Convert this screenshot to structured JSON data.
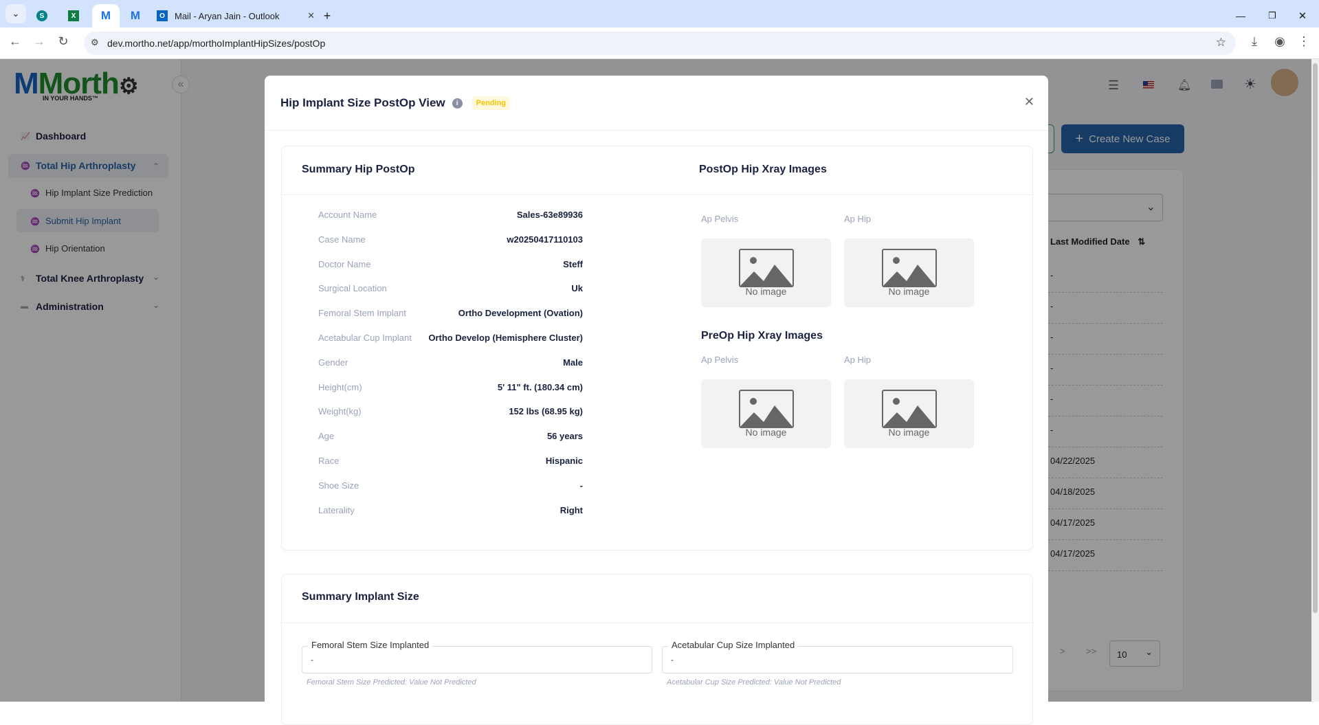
{
  "browser": {
    "tabs": [
      {
        "icon": "sharepoint-icon",
        "label": ""
      },
      {
        "icon": "excel-icon",
        "label": ""
      },
      {
        "icon": "mortho-icon",
        "label": "M",
        "active": true
      },
      {
        "icon": "mortho-icon",
        "label": "M"
      },
      {
        "icon": "outlook-icon",
        "label": "Mail - Aryan Jain - Outlook"
      }
    ],
    "url": "dev.mortho.net/app/morthoImplantHipSizes/postOp",
    "new_tab": "+",
    "close_tab": "✕"
  },
  "app": {
    "logo_text": "Morth",
    "logo_tagline": "IN YOUR HANDS™",
    "accent": "#2563a8"
  },
  "sidebar": {
    "items": [
      {
        "label": "Dashboard"
      },
      {
        "label": "Total Hip Arthroplasty",
        "expanded": true,
        "active": true
      },
      {
        "label": "Hip Implant Size Prediction"
      },
      {
        "label": "Submit Hip Implant",
        "active": true
      },
      {
        "label": "Hip Orientation"
      },
      {
        "label": "Total Knee Arthroplasty"
      },
      {
        "label": "Administration"
      }
    ]
  },
  "background": {
    "create_button": "Create New Case",
    "column_header": "Last Modified Date",
    "rows": [
      "-",
      "-",
      "-",
      "-",
      "-",
      "-",
      "04/22/2025",
      "04/18/2025",
      "04/17/2025",
      "04/17/2025"
    ],
    "page_size": "10",
    "next": ">",
    "last": ">>"
  },
  "modal": {
    "title": "Hip Implant Size PostOp View",
    "status": "Pending",
    "status_color": "#f5c400",
    "summary": {
      "title": "Summary Hip PostOp",
      "rows": [
        {
          "label": "Account Name",
          "value": "Sales-63e89936"
        },
        {
          "label": "Case Name",
          "value": "w20250417110103"
        },
        {
          "label": "Doctor Name",
          "value": "Steff"
        },
        {
          "label": "Surgical Location",
          "value": "Uk"
        },
        {
          "label": "Femoral Stem Implant",
          "value": "Ortho Development (Ovation)"
        },
        {
          "label": "Acetabular Cup Implant",
          "value": "Ortho Develop (Hemisphere Cluster)"
        },
        {
          "label": "Gender",
          "value": "Male"
        },
        {
          "label": "Height(cm)",
          "value": "5' 11\" ft. (180.34 cm)"
        },
        {
          "label": "Weight(kg)",
          "value": "152 lbs (68.95 kg)"
        },
        {
          "label": "Age",
          "value": "56 years"
        },
        {
          "label": "Race",
          "value": "Hispanic"
        },
        {
          "label": "Shoe Size",
          "value": "-"
        },
        {
          "label": "Laterality",
          "value": "Right"
        }
      ]
    },
    "postop_images": {
      "title": "PostOp Hip Xray Images",
      "items": [
        {
          "label": "Ap Pelvis",
          "placeholder": "No image"
        },
        {
          "label": "Ap Hip",
          "placeholder": "No image"
        }
      ]
    },
    "preop_images": {
      "title": "PreOp Hip Xray Images",
      "items": [
        {
          "label": "Ap Pelvis",
          "placeholder": "No image"
        },
        {
          "label": "Ap Hip",
          "placeholder": "No image"
        }
      ]
    },
    "implant": {
      "title": "Summary Implant Size",
      "fields": [
        {
          "label": "Femoral Stem Size Implanted",
          "value": "-",
          "help": "Femoral Stem Size Predicted: Value Not Predicted"
        },
        {
          "label": "Acetabular Cup Size Implanted",
          "value": "-",
          "help": "Acetabular Cup Size Predicted: Value Not Predicted"
        }
      ]
    }
  }
}
